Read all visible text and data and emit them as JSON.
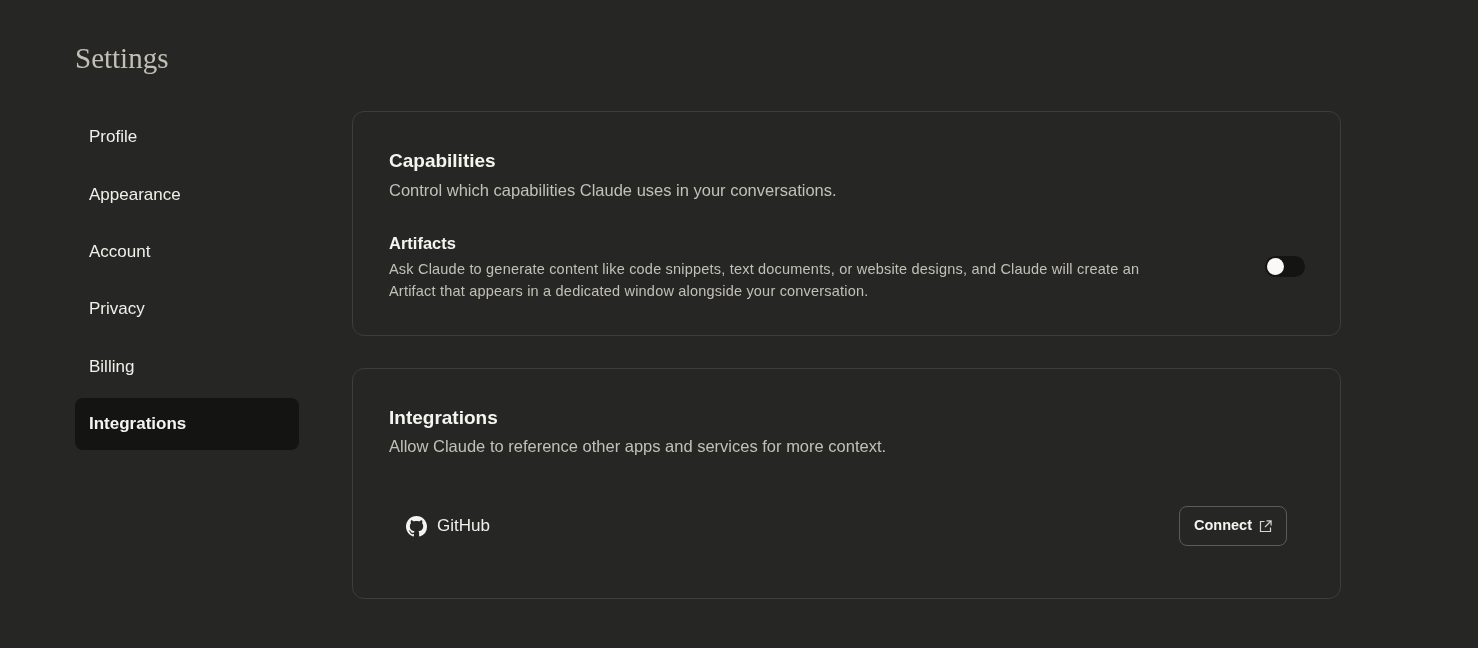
{
  "title": "Settings",
  "nav": [
    {
      "label": "Profile",
      "selected": false
    },
    {
      "label": "Appearance",
      "selected": false
    },
    {
      "label": "Account",
      "selected": false
    },
    {
      "label": "Privacy",
      "selected": false
    },
    {
      "label": "Billing",
      "selected": false
    },
    {
      "label": "Integrations",
      "selected": true
    }
  ],
  "capabilities": {
    "title": "Capabilities",
    "subtitle": "Control which capabilities Claude uses in your conversations.",
    "settings": [
      {
        "title": "Artifacts",
        "description": "Ask Claude to generate content like code snippets, text documents, or website designs, and Claude will create an Artifact that appears in a dedicated window alongside your conversation.",
        "on": false
      }
    ]
  },
  "integrations": {
    "title": "Integrations",
    "subtitle": "Allow Claude to reference other apps and services for more context.",
    "items": [
      {
        "name": "GitHub",
        "button": "Connect"
      }
    ]
  }
}
